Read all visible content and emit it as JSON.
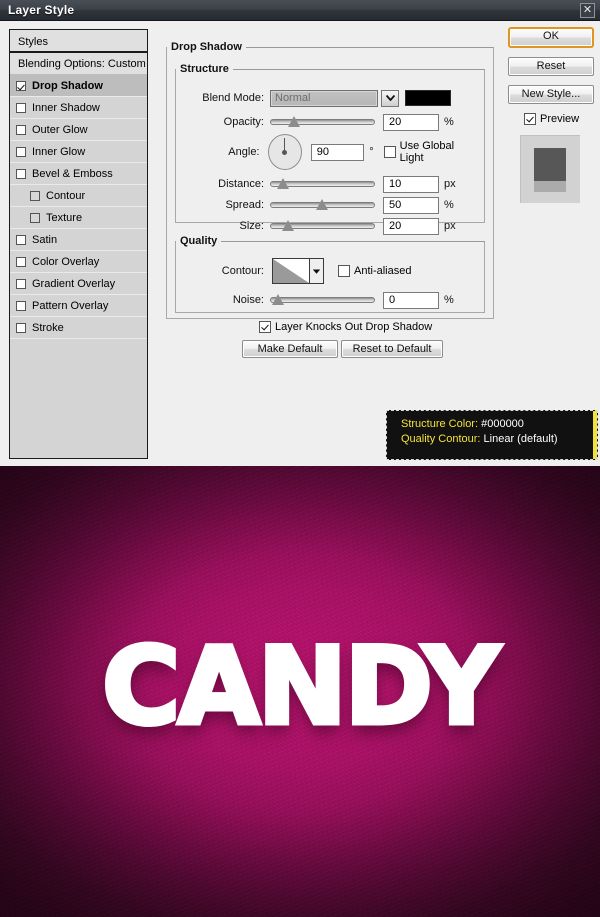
{
  "window": {
    "title": "Layer Style",
    "close_label": "✕"
  },
  "styles_panel": {
    "header": "Styles",
    "items": [
      {
        "label": "Blending Options: Custom",
        "checkbox": false,
        "checked": false,
        "indent": false,
        "selected": false,
        "kind": "blending"
      },
      {
        "label": "Drop Shadow",
        "checkbox": true,
        "checked": true,
        "indent": false,
        "selected": true,
        "kind": "effect"
      },
      {
        "label": "Inner Shadow",
        "checkbox": true,
        "checked": false,
        "indent": false,
        "selected": false,
        "kind": "effect"
      },
      {
        "label": "Outer Glow",
        "checkbox": true,
        "checked": false,
        "indent": false,
        "selected": false,
        "kind": "effect"
      },
      {
        "label": "Inner Glow",
        "checkbox": true,
        "checked": false,
        "indent": false,
        "selected": false,
        "kind": "effect"
      },
      {
        "label": "Bevel & Emboss",
        "checkbox": true,
        "checked": false,
        "indent": false,
        "selected": false,
        "kind": "effect"
      },
      {
        "label": "Contour",
        "checkbox": true,
        "checked": false,
        "indent": true,
        "selected": false,
        "kind": "sub"
      },
      {
        "label": "Texture",
        "checkbox": true,
        "checked": false,
        "indent": true,
        "selected": false,
        "kind": "sub"
      },
      {
        "label": "Satin",
        "checkbox": true,
        "checked": false,
        "indent": false,
        "selected": false,
        "kind": "effect"
      },
      {
        "label": "Color Overlay",
        "checkbox": true,
        "checked": false,
        "indent": false,
        "selected": false,
        "kind": "effect"
      },
      {
        "label": "Gradient Overlay",
        "checkbox": true,
        "checked": false,
        "indent": false,
        "selected": false,
        "kind": "effect"
      },
      {
        "label": "Pattern Overlay",
        "checkbox": true,
        "checked": false,
        "indent": false,
        "selected": false,
        "kind": "effect"
      },
      {
        "label": "Stroke",
        "checkbox": true,
        "checked": false,
        "indent": false,
        "selected": false,
        "kind": "effect"
      }
    ]
  },
  "drop_shadow": {
    "legend": "Drop Shadow",
    "structure": {
      "legend": "Structure",
      "blend_mode": {
        "label": "Blend Mode:",
        "value": "Normal"
      },
      "color": {
        "hex": "#000000"
      },
      "opacity": {
        "label": "Opacity:",
        "value": "20",
        "unit": "%",
        "percent": 20
      },
      "angle": {
        "label": "Angle:",
        "value": "90",
        "unit": "°",
        "degrees": 90
      },
      "use_global_light": {
        "label": "Use Global Light",
        "checked": false
      },
      "distance": {
        "label": "Distance:",
        "value": "10",
        "unit": "px",
        "percent": 8
      },
      "spread": {
        "label": "Spread:",
        "value": "50",
        "unit": "%",
        "percent": 50
      },
      "size": {
        "label": "Size:",
        "value": "20",
        "unit": "px",
        "percent": 13
      }
    },
    "quality": {
      "legend": "Quality",
      "contour": {
        "label": "Contour:",
        "name": "Linear"
      },
      "anti_aliased": {
        "label": "Anti-aliased",
        "checked": false
      },
      "noise": {
        "label": "Noise:",
        "value": "0",
        "unit": "%",
        "percent": 2
      }
    },
    "knockout": {
      "label": "Layer Knocks Out Drop Shadow",
      "checked": true
    },
    "make_default": "Make Default",
    "reset_to_default": "Reset to Default"
  },
  "buttons": {
    "ok": "OK",
    "reset": "Reset",
    "new_style": "New Style...",
    "preview": {
      "label": "Preview",
      "checked": true
    }
  },
  "tooltip": {
    "line1_key": "Structure Color:",
    "line1_value": "#000000",
    "line2_key": "Quality Contour:",
    "line2_value": "Linear (default)",
    "accent": "#f2e33a"
  },
  "artwork": {
    "text": "CANDY",
    "background_center": "#bb1470",
    "background_edge": "#520a33",
    "text_color": "#ffffff"
  }
}
